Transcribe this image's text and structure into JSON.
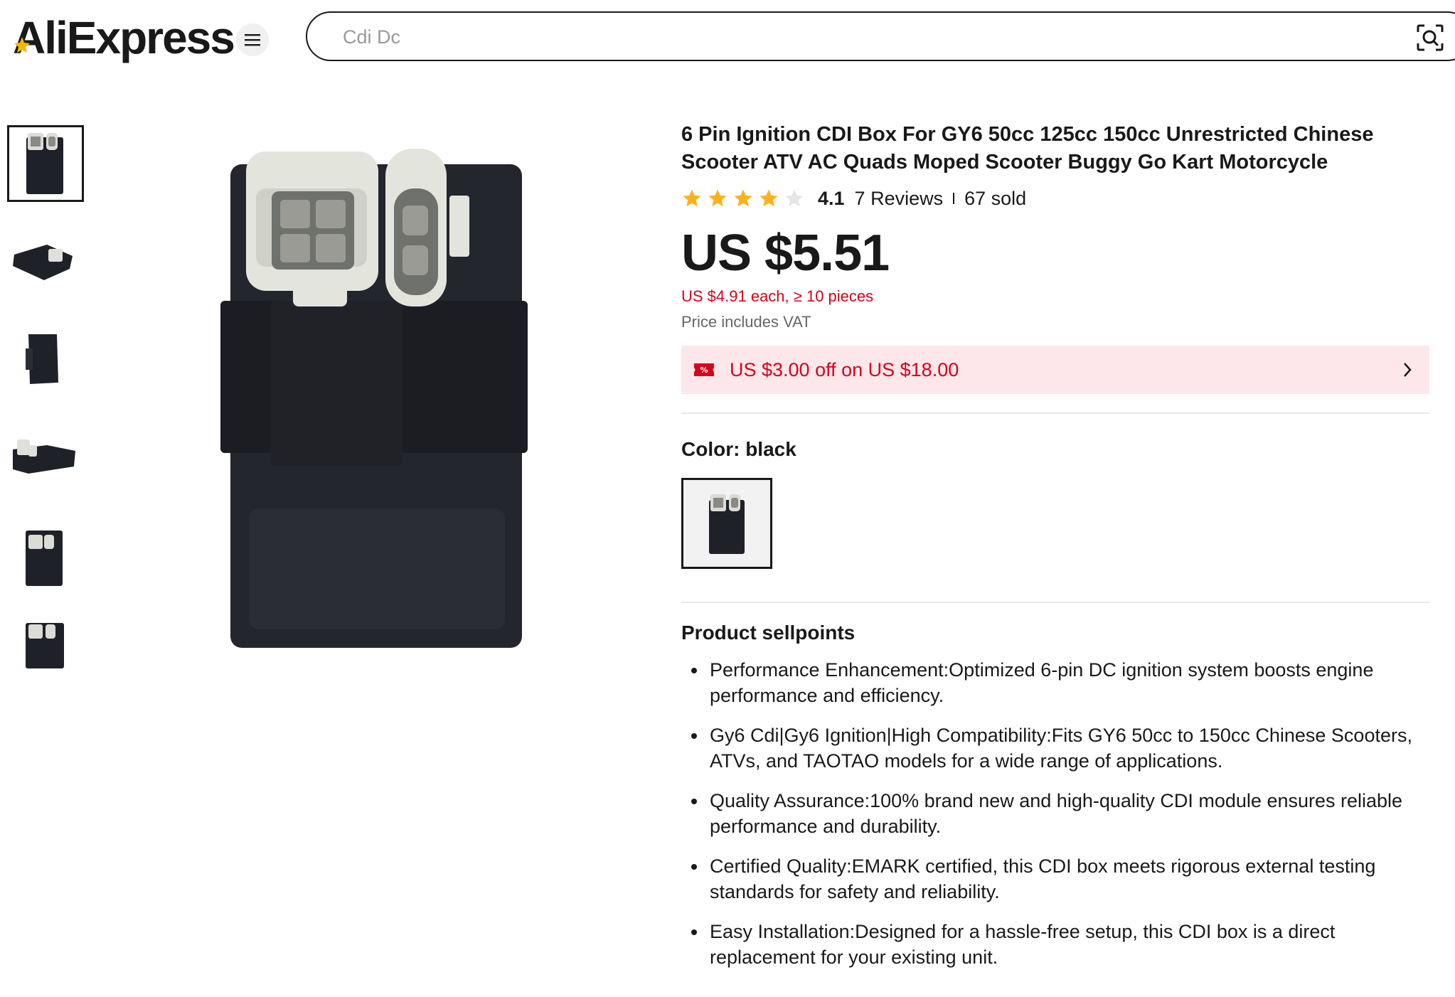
{
  "header": {
    "logo_text": "AliExpress",
    "menu_icon": "hamburger-menu-icon",
    "search_placeholder": "Cdi Dc",
    "search_value": "",
    "camera_icon": "image-search-icon"
  },
  "gallery": {
    "thumbnails": [
      "thumbnail-front",
      "thumbnail-angle-left",
      "thumbnail-side",
      "thumbnail-connector-side",
      "thumbnail-front-2",
      "thumbnail-top"
    ],
    "active_index": 0
  },
  "product": {
    "title": "6 Pin Ignition CDI Box For GY6 50cc 125cc 150cc Unrestricted Chinese Scooter ATV AC Quads Moped Scooter Buggy Go Kart Motorcycle",
    "rating": "4.1",
    "rating_stars": 4.1,
    "reviews": "7 Reviews",
    "sold": "67 sold",
    "price": "US $5.51",
    "bulk_price": "US $4.91 each, ≥ 10 pieces",
    "vat_note": "Price includes VAT",
    "coupon_text": "US $3.00 off on US $18.00",
    "color_label": "Color: black",
    "sellpoints_title": "Product sellpoints",
    "sellpoints": [
      "Performance Enhancement:Optimized 6-pin DC ignition system boosts engine performance and efficiency.",
      "Gy6 Cdi|Gy6 Ignition|High Compatibility:Fits GY6 50cc to 150cc Chinese Scooters, ATVs, and TAOTAO models for a wide range of applications.",
      "Quality Assurance:100% brand new and high-quality CDI module ensures reliable performance and durability.",
      "Certified Quality:EMARK certified, this CDI box meets rigorous external testing standards for safety and reliability.",
      "Easy Installation:Designed for a hassle-free setup, this CDI box is a direct replacement for your existing unit."
    ]
  },
  "colors": {
    "brand_red": "#d3031c",
    "coupon_bg": "#fde7ea",
    "star_gold": "#fdb21d",
    "text": "#191919"
  }
}
